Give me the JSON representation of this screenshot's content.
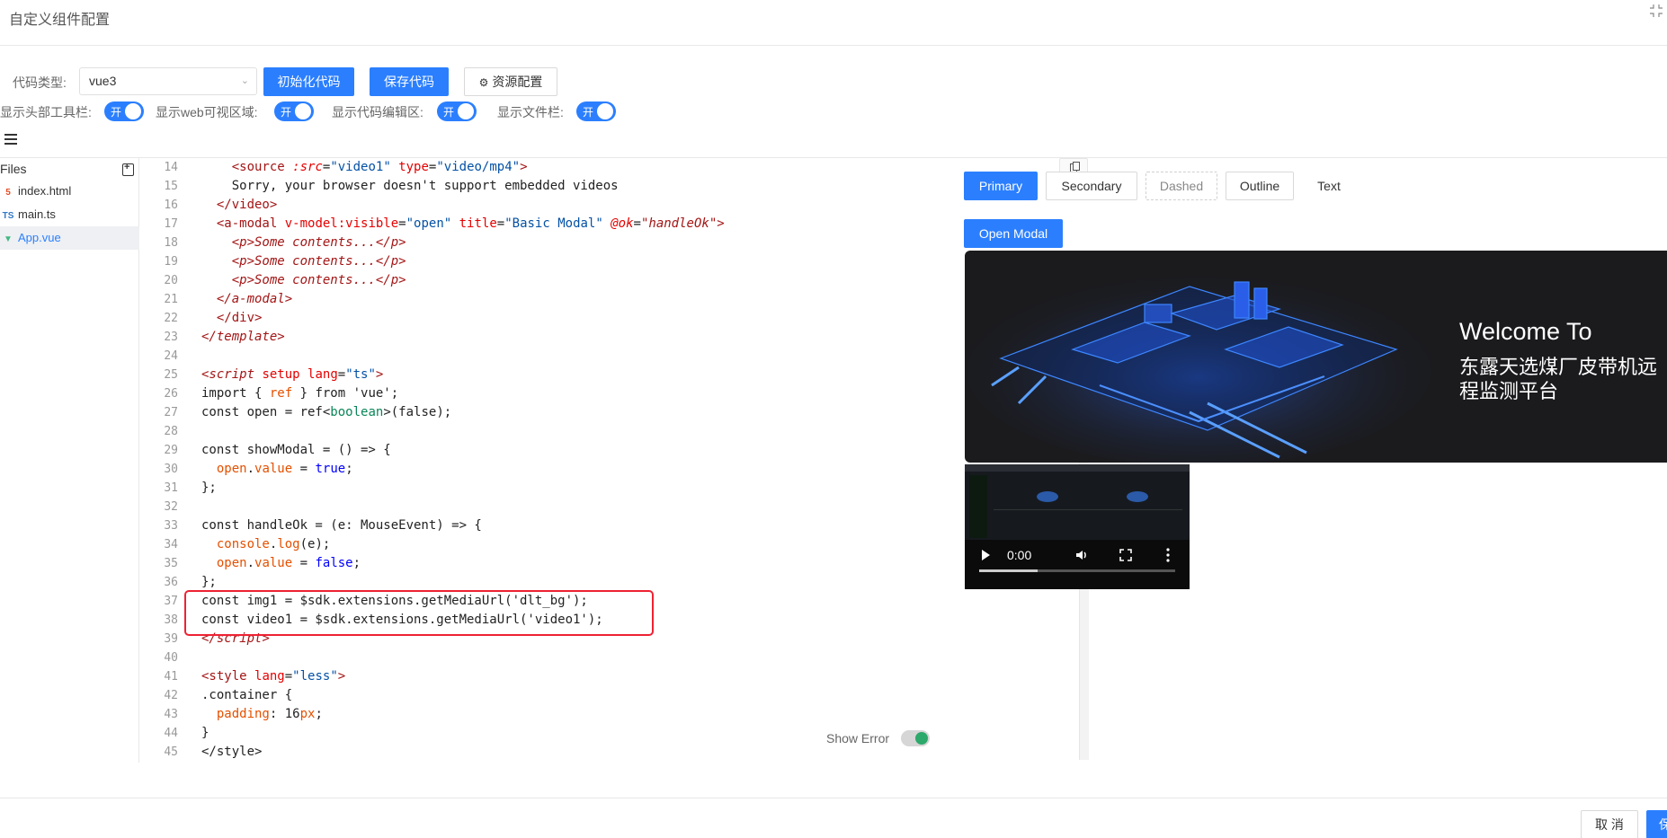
{
  "dialog": {
    "title": "自定义组件配置",
    "cancel_label": "取 消",
    "confirm_label": "保"
  },
  "toolbar": {
    "code_type_label": "代码类型:",
    "code_type_value": "vue3",
    "init_code_label": "初始化代码",
    "save_code_label": "保存代码",
    "resource_config_label": "资源配置"
  },
  "toggles": [
    {
      "label": "显示头部工具栏:",
      "state": "开"
    },
    {
      "label": "显示web可视区域:",
      "state": "开"
    },
    {
      "label": "显示代码编辑区:",
      "state": "开"
    },
    {
      "label": "显示文件栏:",
      "state": "开"
    }
  ],
  "files": {
    "header": "Files",
    "items": [
      {
        "name": "index.html",
        "icon": "html5-icon",
        "icon_glyph": "5",
        "color": "#e44d26"
      },
      {
        "name": "main.ts",
        "icon": "typescript-icon",
        "icon_glyph": "TS",
        "color": "#3178c6"
      },
      {
        "name": "App.vue",
        "icon": "vue-icon",
        "icon_glyph": "▼",
        "color": "#41b883"
      }
    ],
    "active": "App.vue"
  },
  "editor": {
    "show_error_label": "Show Error",
    "lines": [
      {
        "n": "14",
        "html": "    <span class='t'>&lt;source</span> <span class='ai'>:src</span>=<span class='s'>\"video1\"</span> <span class='a'>type</span>=<span class='s'>\"video/mp4\"</span><span class='t'>&gt;</span>"
      },
      {
        "n": "15",
        "html": "    Sorry, your browser doesn't support embedded videos"
      },
      {
        "n": "16",
        "html": "  <span class='t'>&lt;/video&gt;</span>"
      },
      {
        "n": "17",
        "html": "  <span class='t'>&lt;a-modal</span> <span class='a'>v-model:visible</span>=<span class='s'>\"open\"</span> <span class='a'>title</span>=<span class='s'>\"Basic Modal\"</span> <span class='ai'>@ok</span>=<span class='ti'>\"handleOk\"</span><span class='t'>&gt;</span>"
      },
      {
        "n": "18",
        "html": "    <span class='ti'>&lt;p&gt;Some contents...&lt;/p&gt;</span>"
      },
      {
        "n": "19",
        "html": "    <span class='ti'>&lt;p&gt;Some contents...&lt;/p&gt;</span>"
      },
      {
        "n": "20",
        "html": "    <span class='ti'>&lt;p&gt;Some contents...&lt;/p&gt;</span>"
      },
      {
        "n": "21",
        "html": "  <span class='ti'>&lt;/a-modal&gt;</span>"
      },
      {
        "n": "22",
        "html": "  <span class='t'>&lt;/div&gt;</span>"
      },
      {
        "n": "23",
        "html": "<span class='ti'>&lt;/template&gt;</span>"
      },
      {
        "n": "24",
        "html": ""
      },
      {
        "n": "25",
        "html": "<span class='ti'>&lt;script</span> <span class='a'>setup</span> <span class='a'>lang</span>=<span class='s'>\"ts\"</span><span class='t'>&gt;</span>"
      },
      {
        "n": "26",
        "html": "import { <span class='v'>ref</span> } from 'vue';"
      },
      {
        "n": "27",
        "html": "const open = ref&lt;<span class='g'>boolean</span>&gt;(false);"
      },
      {
        "n": "28",
        "html": ""
      },
      {
        "n": "29",
        "html": "const showModal = () =&gt; {"
      },
      {
        "n": "30",
        "html": "  <span class='v'>open</span>.<span class='v'>value</span> = <span class='k'>true</span>;"
      },
      {
        "n": "31",
        "html": "};"
      },
      {
        "n": "32",
        "html": ""
      },
      {
        "n": "33",
        "html": "const handleOk = (e: MouseEvent) =&gt; {"
      },
      {
        "n": "34",
        "html": "  <span class='v'>console</span>.<span class='v'>log</span>(e);"
      },
      {
        "n": "35",
        "html": "  <span class='v'>open</span>.<span class='v'>value</span> = <span class='k'>false</span>;"
      },
      {
        "n": "36",
        "html": "};"
      },
      {
        "n": "37",
        "html": "const img1 = $sdk.extensions.getMediaUrl('dlt_bg');"
      },
      {
        "n": "38",
        "html": "const video1 = $sdk.extensions.getMediaUrl('video1');"
      },
      {
        "n": "39",
        "html": "<span class='ti'>&lt;/script&gt;</span>"
      },
      {
        "n": "40",
        "html": ""
      },
      {
        "n": "41",
        "html": "<span class='t'>&lt;style</span> <span class='a'>lang</span>=<span class='s'>\"less\"</span><span class='t'>&gt;</span>"
      },
      {
        "n": "42",
        "html": ".container {"
      },
      {
        "n": "43",
        "html": "  <span class='v'>padding</span>: 16<span class='v'>px</span>;"
      },
      {
        "n": "44",
        "html": "}"
      },
      {
        "n": "45",
        "html": "&lt;/style&gt;"
      }
    ]
  },
  "preview": {
    "buttons": [
      {
        "label": "Primary",
        "style": "primary"
      },
      {
        "label": "Secondary",
        "style": "sec"
      },
      {
        "label": "Dashed",
        "style": "dash"
      },
      {
        "label": "Outline",
        "style": "sec"
      },
      {
        "label": "Text",
        "style": "text"
      }
    ],
    "open_modal_label": "Open Modal",
    "banner_heading": "Welcome To",
    "banner_subtitle": "东露天选煤厂皮带机远程监测平台",
    "video_time": "0:00",
    "video_progress": 0.3
  },
  "colors": {
    "accent": "#2b7fff",
    "highlight_box": "#e22233",
    "banner_bg": "#1b1b1e",
    "factory_glow": "#2d6bff"
  }
}
